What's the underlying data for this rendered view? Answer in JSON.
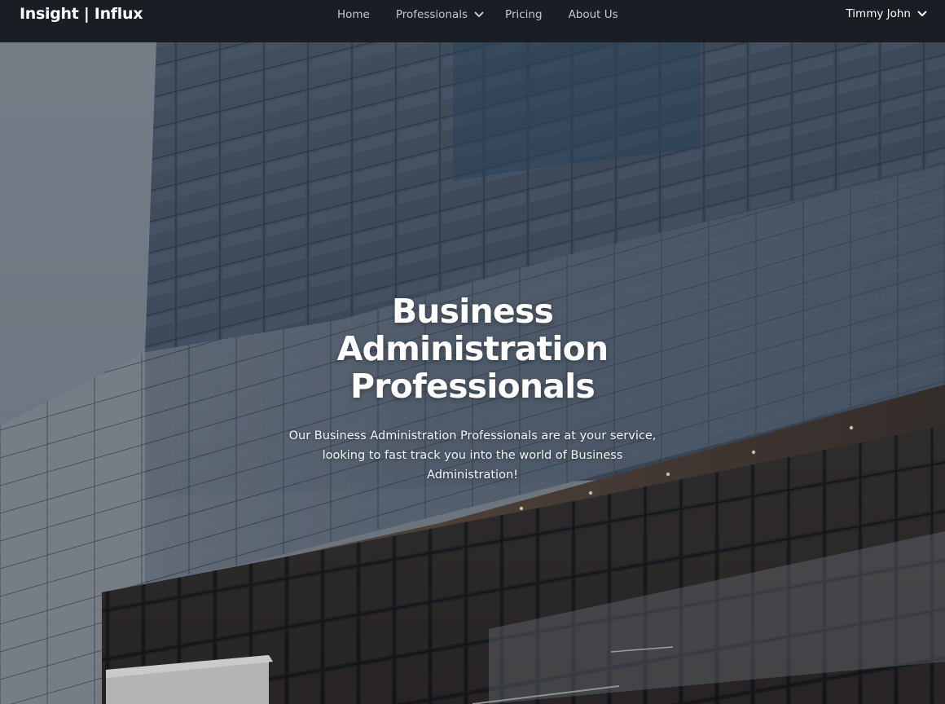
{
  "navbar": {
    "brand": "Insight | Influx",
    "links": {
      "home": "Home",
      "professionals": "Professionals",
      "pricing": "Pricing",
      "about": "About Us"
    },
    "user_name": "Timmy John"
  },
  "hero": {
    "title": "Business Administration Professionals",
    "subtitle": "Our Business Administration Professionals are at your service, looking to fast track you into the world of Business Administration!"
  },
  "icons": {
    "professionals_dropdown": "chevron-down-icon",
    "user_dropdown": "chevron-down-icon"
  },
  "colors": {
    "navbar_bg": "#1a1d23",
    "nav_link": "#c4c8ce",
    "hero_text": "#ffffff"
  }
}
